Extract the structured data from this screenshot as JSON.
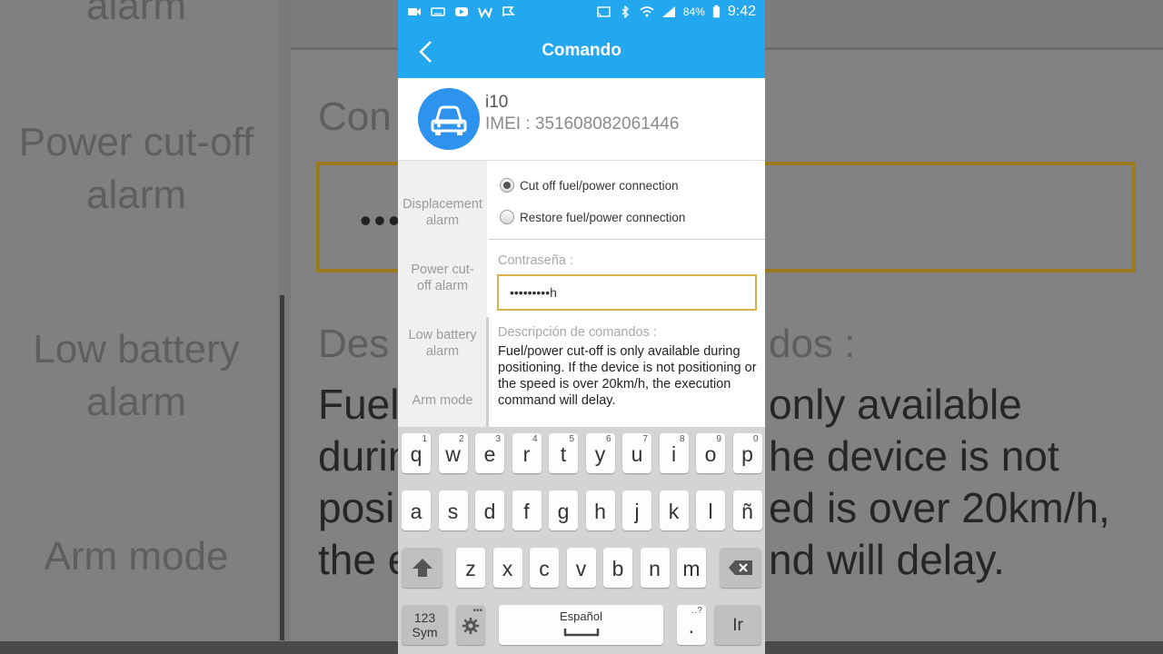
{
  "background": {
    "left_labels": [
      "Power cut-off alarm",
      "Low battery alarm",
      "Arm mode"
    ],
    "top_left_fragment": "alarm",
    "field_fragment": "Con",
    "desc_fragment_left": "Des",
    "desc_fragment_right": "dos :",
    "dots": "•••",
    "lines": [
      "Fuel",
      "durin",
      "posi",
      "the e"
    ],
    "lines_right": [
      "only available",
      "he device is not",
      "ed is over 20km/h,",
      "nd will delay."
    ]
  },
  "status_bar": {
    "battery": "84%",
    "time": "9:42"
  },
  "app_bar": {
    "title": "Comando"
  },
  "device": {
    "name": "i10",
    "imei": "IMEI : 351608082061446"
  },
  "sidebar": {
    "items": [
      {
        "label": "Displacement alarm"
      },
      {
        "label": "Power cut-off alarm"
      },
      {
        "label": "Low battery alarm"
      },
      {
        "label": "Arm mode"
      }
    ]
  },
  "options": [
    {
      "label": "Cut off fuel/power connection",
      "selected": true
    },
    {
      "label": "Restore fuel/power connection",
      "selected": false
    }
  ],
  "password": {
    "label": "Contraseña :",
    "value": "•••••••••h"
  },
  "description": {
    "label": "Descripción de comandos :",
    "text": "Fuel/power cut-off is only available during positioning. If the device is not positioning or the speed is over 20km/h, the execution command will delay."
  },
  "keyboard": {
    "row1": [
      {
        "k": "q",
        "h": "1"
      },
      {
        "k": "w",
        "h": "2"
      },
      {
        "k": "e",
        "h": "3"
      },
      {
        "k": "r",
        "h": "4"
      },
      {
        "k": "t",
        "h": "5"
      },
      {
        "k": "y",
        "h": "6"
      },
      {
        "k": "u",
        "h": "7"
      },
      {
        "k": "i",
        "h": "8"
      },
      {
        "k": "o",
        "h": "9"
      },
      {
        "k": "p",
        "h": "0"
      }
    ],
    "row2": [
      "a",
      "s",
      "d",
      "f",
      "g",
      "h",
      "j",
      "k",
      "l",
      "ñ"
    ],
    "row3": [
      "z",
      "x",
      "c",
      "v",
      "b",
      "n",
      "m"
    ],
    "sym_line1": "123",
    "sym_line2": "Sym",
    "space_label": "Español",
    "period": ".",
    "period_hint": "‥?",
    "go_label": "Ir"
  }
}
